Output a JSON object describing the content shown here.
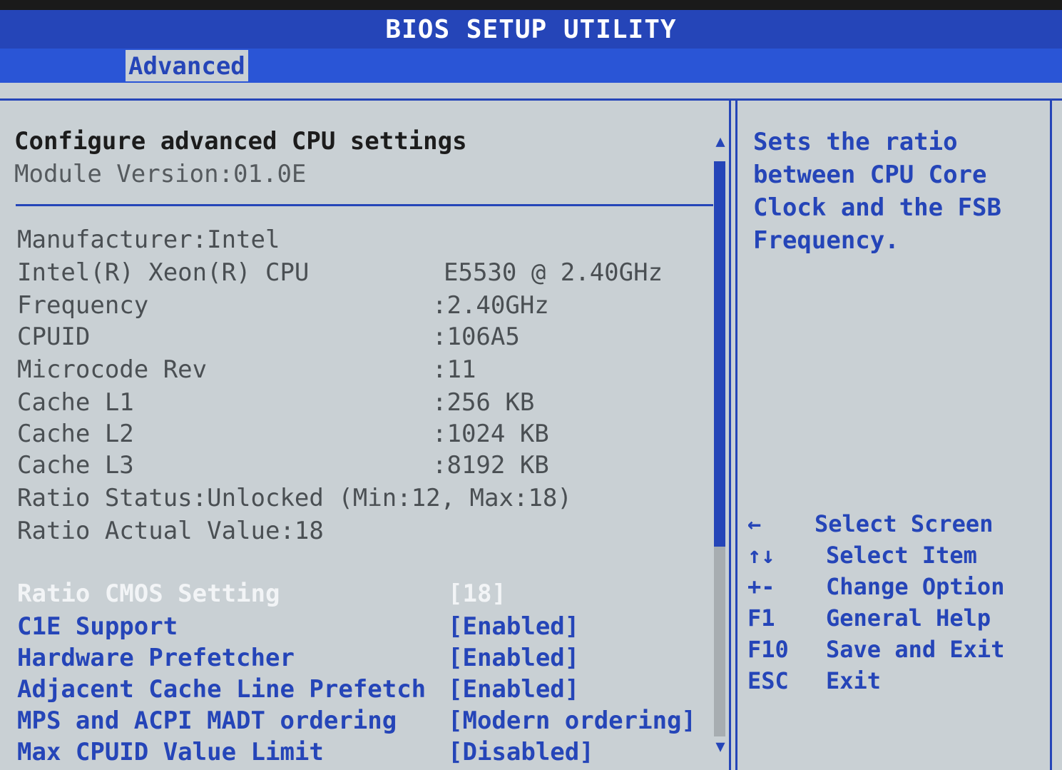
{
  "title": "BIOS SETUP UTILITY",
  "active_tab": "Advanced",
  "left": {
    "heading": "Configure advanced CPU settings",
    "module_version": "Module Version:01.0E",
    "info_rows": [
      {
        "label": "Manufacturer:Intel",
        "value": ""
      },
      {
        "label": "Intel(R) Xeon(R) CPU",
        "value": "E5530  @ 2.40GHz"
      },
      {
        "label": "Frequency",
        "value": ":2.40GHz"
      },
      {
        "label": "CPUID",
        "value": ":106A5"
      },
      {
        "label": "Microcode Rev",
        "value": ":11"
      },
      {
        "label": "Cache L1",
        "value": ":256 KB"
      },
      {
        "label": "Cache L2",
        "value": ":1024 KB"
      },
      {
        "label": "Cache L3",
        "value": ":8192 KB"
      },
      {
        "label": "Ratio Status:Unlocked (Min:12, Max:18)",
        "value": ""
      },
      {
        "label": "Ratio Actual Value:18",
        "value": ""
      }
    ],
    "options": [
      {
        "label": "Ratio CMOS Setting",
        "value": "[18]",
        "selected": true
      },
      {
        "label": "C1E Support",
        "value": "[Enabled]"
      },
      {
        "label": "Hardware Prefetcher",
        "value": "[Enabled]"
      },
      {
        "label": "Adjacent Cache Line Prefetch",
        "value": "[Enabled]"
      },
      {
        "label": "MPS and ACPI MADT ordering",
        "value": "[Modern ordering]"
      },
      {
        "label": "Max CPUID Value Limit",
        "value": "[Disabled]"
      }
    ]
  },
  "help": {
    "lines": [
      "Sets the ratio",
      "between CPU Core",
      "Clock and the FSB",
      "Frequency."
    ]
  },
  "keys": [
    {
      "key": "←",
      "desc": "Select Screen"
    },
    {
      "key": "↑↓",
      "desc": "Select Item"
    },
    {
      "key": "+-",
      "desc": "Change Option"
    },
    {
      "key": "F1",
      "desc": "General Help"
    },
    {
      "key": "F10",
      "desc": "Save and Exit"
    },
    {
      "key": "ESC",
      "desc": "Exit"
    }
  ],
  "colors": {
    "accent": "#2545b8",
    "background": "#c9d0d4",
    "selected_text": "#f2f4f6"
  }
}
